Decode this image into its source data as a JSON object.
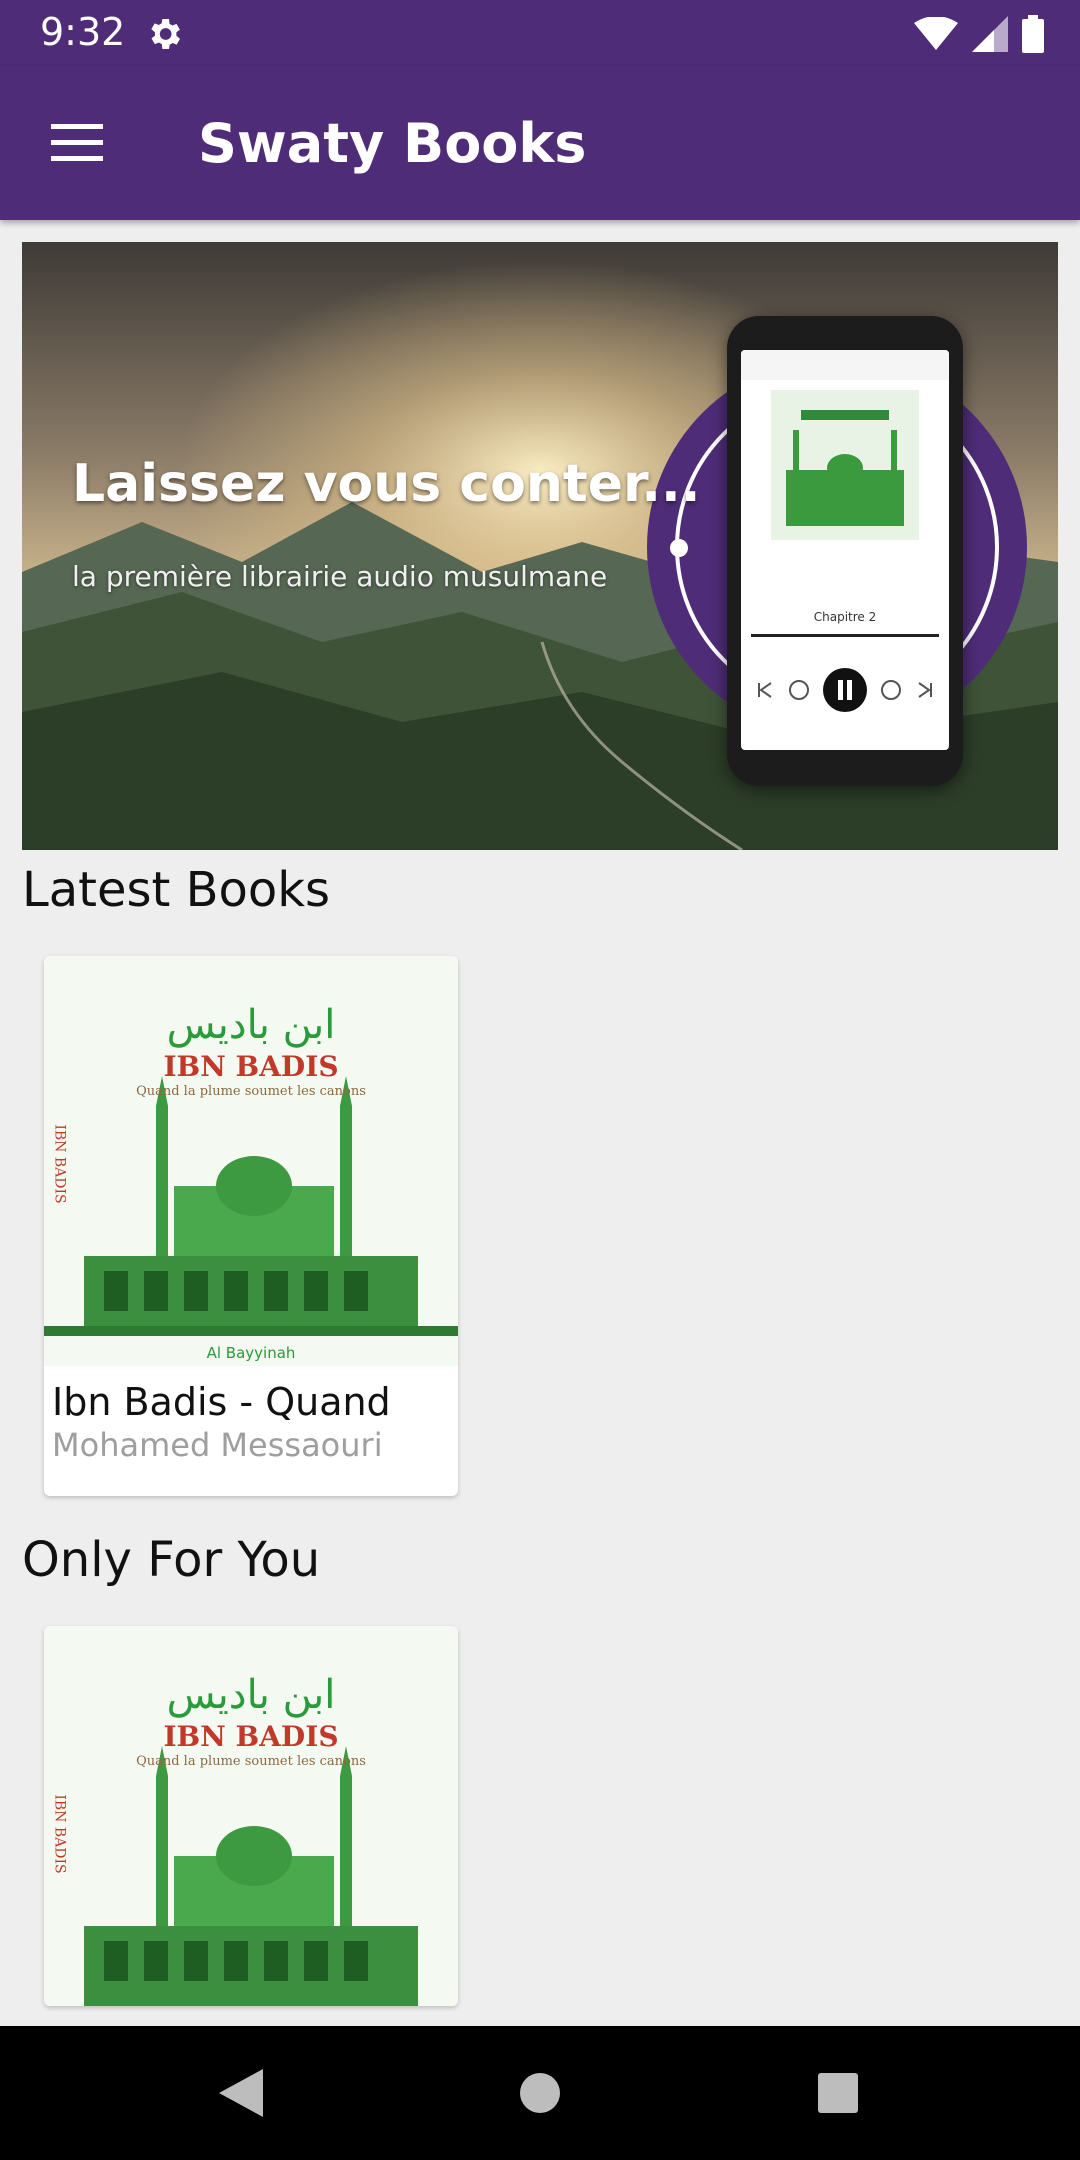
{
  "status_bar": {
    "time": "9:32",
    "icons": [
      "settings-gear-icon",
      "wifi-icon",
      "signal-icon",
      "battery-icon"
    ]
  },
  "app_bar": {
    "title": "Swaty Books",
    "menu_icon": "hamburger-menu-icon",
    "background_color": "#4e2c77"
  },
  "banner": {
    "title": "Laissez vous conter...",
    "subtitle": "la première librairie audio musulmane",
    "phone_chapter": "Chapitre 2"
  },
  "sections": {
    "latest_title": "Latest Books",
    "only_for_you_title": "Only For You"
  },
  "latest_books": [
    {
      "title": "Ibn Badis - Quand",
      "author": "Mohamed Messaouri",
      "cover": {
        "arabic_title": "ابن باديس",
        "latin_title": "IBN BADIS",
        "tagline": "Quand la plume soumet les canons",
        "spine_text": "IBN BADIS",
        "publisher": "Al Bayyinah"
      }
    }
  ],
  "only_for_you": [
    {
      "cover": {
        "arabic_title": "ابن باديس",
        "latin_title": "IBN BADIS",
        "tagline": "Quand la plume soumet les canons",
        "spine_text": "IBN BADIS"
      }
    }
  ],
  "nav_bar": {
    "icons": [
      "back-triangle-icon",
      "home-circle-icon",
      "recents-square-icon"
    ]
  }
}
